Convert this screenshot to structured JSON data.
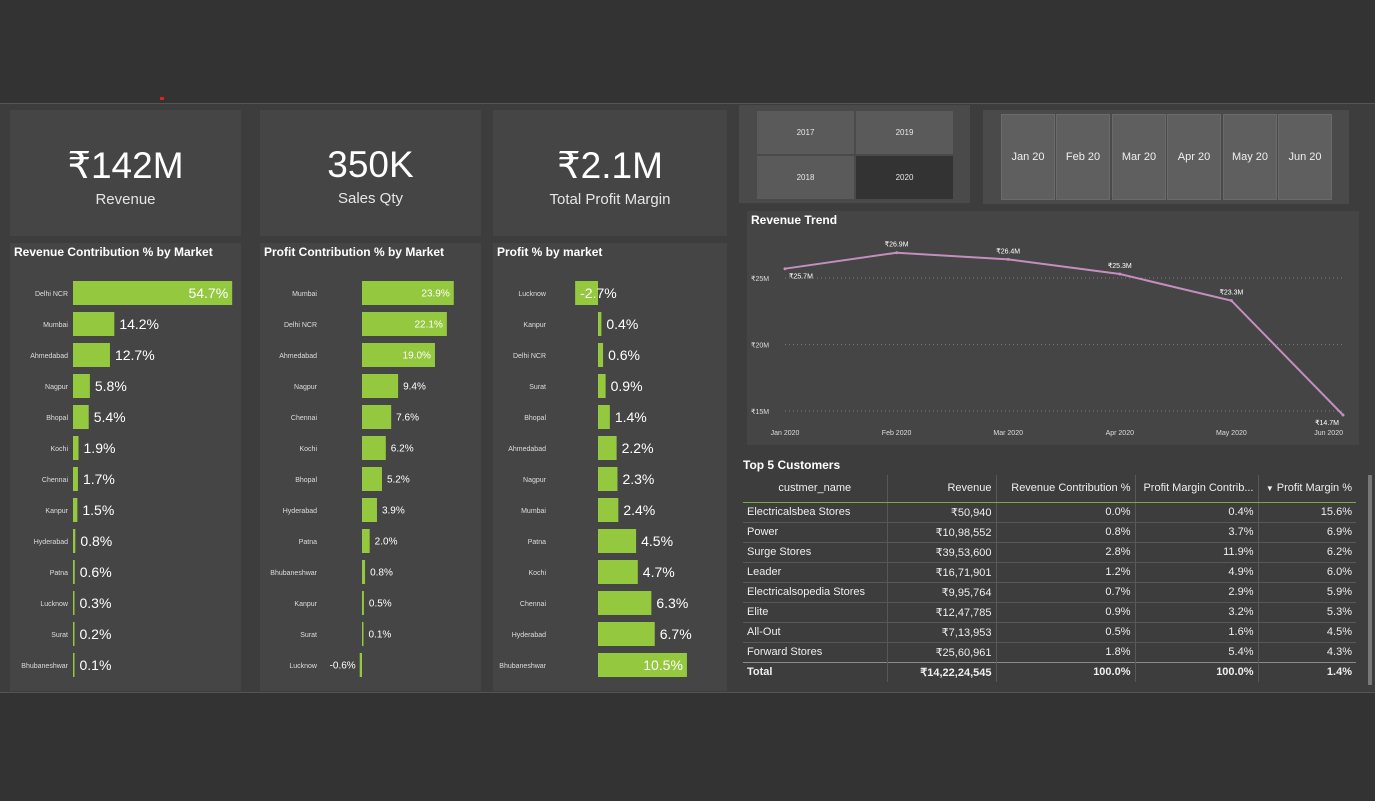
{
  "kpis": [
    {
      "value": "₹142M",
      "label": "Revenue"
    },
    {
      "value": "350K",
      "label": "Sales Qty"
    },
    {
      "value": "₹2.1M",
      "label": "Total Profit Margin"
    }
  ],
  "year_slicer": {
    "years": [
      "2017",
      "2019",
      "2018",
      "2020"
    ],
    "selected": "2020"
  },
  "month_slicer": {
    "months": [
      "Jan 20",
      "Feb 20",
      "Mar 20",
      "Apr 20",
      "May 20",
      "Jun 20"
    ]
  },
  "colors": {
    "bar": "#94c83e",
    "line": "#c48fbf",
    "background": "#333333",
    "panel": "#454545"
  },
  "chart_data": [
    {
      "type": "bar",
      "title": "Revenue Contribution % by Market",
      "categories": [
        "Delhi NCR",
        "Mumbai",
        "Ahmedabad",
        "Nagpur",
        "Bhopal",
        "Kochi",
        "Chennai",
        "Kanpur",
        "Hyderabad",
        "Patna",
        "Lucknow",
        "Surat",
        "Bhubaneshwar"
      ],
      "values": [
        54.7,
        14.2,
        12.7,
        5.8,
        5.4,
        1.9,
        1.7,
        1.5,
        0.8,
        0.6,
        0.3,
        0.2,
        0.1
      ],
      "labels": [
        "54.7%",
        "14.2%",
        "12.7%",
        "5.8%",
        "5.4%",
        "1.9%",
        "1.7%",
        "1.5%",
        "0.8%",
        "0.6%",
        "0.3%",
        "0.2%",
        "0.1%"
      ],
      "orientation": "horizontal"
    },
    {
      "type": "bar",
      "title": "Profit Contribution % by Market",
      "categories": [
        "Mumbai",
        "Delhi NCR",
        "Ahmedabad",
        "Nagpur",
        "Chennai",
        "Kochi",
        "Bhopal",
        "Hyderabad",
        "Patna",
        "Bhubaneshwar",
        "Kanpur",
        "Surat",
        "Lucknow"
      ],
      "values": [
        23.9,
        22.1,
        19.0,
        9.4,
        7.6,
        6.2,
        5.2,
        3.9,
        2.0,
        0.8,
        0.5,
        0.1,
        -0.6
      ],
      "labels": [
        "23.9%",
        "22.1%",
        "19.0%",
        "9.4%",
        "7.6%",
        "6.2%",
        "5.2%",
        "3.9%",
        "2.0%",
        "0.8%",
        "0.5%",
        "0.1%",
        "-0.6%"
      ],
      "orientation": "horizontal"
    },
    {
      "type": "bar",
      "title": "Profit % by market",
      "categories": [
        "Lucknow",
        "Kanpur",
        "Delhi NCR",
        "Surat",
        "Bhopal",
        "Ahmedabad",
        "Nagpur",
        "Mumbai",
        "Patna",
        "Kochi",
        "Chennai",
        "Hyderabad",
        "Bhubaneshwar"
      ],
      "values": [
        -2.7,
        0.4,
        0.6,
        0.9,
        1.4,
        2.2,
        2.3,
        2.4,
        4.5,
        4.7,
        6.3,
        6.7,
        10.5
      ],
      "labels": [
        "-2.7%",
        "0.4%",
        "0.6%",
        "0.9%",
        "1.4%",
        "2.2%",
        "2.3%",
        "2.4%",
        "4.5%",
        "4.7%",
        "6.3%",
        "6.7%",
        "10.5%"
      ],
      "orientation": "horizontal"
    },
    {
      "type": "line",
      "title": "Revenue Trend",
      "x": [
        "Jan 2020",
        "Feb 2020",
        "Mar 2020",
        "Apr 2020",
        "May 2020",
        "Jun 2020"
      ],
      "y": [
        25.7,
        26.9,
        26.4,
        25.3,
        23.3,
        14.7
      ],
      "labels": [
        "₹25.7M",
        "₹26.9M",
        "₹26.4M",
        "₹25.3M",
        "₹23.3M",
        "₹14.7M"
      ],
      "yticks": [
        "₹15M",
        "₹20M",
        "₹25M"
      ],
      "ytick_values": [
        15,
        20,
        25
      ],
      "grid": true
    },
    {
      "type": "table",
      "title": "Top 5 Customers",
      "columns": [
        "custmer_name",
        "Revenue",
        "Revenue Contribution %",
        "Profit Margin Contrib...",
        "Profit Margin %"
      ],
      "rows": [
        [
          "Electricalsbea Stores",
          "₹50,940",
          "0.0%",
          "0.4%",
          "15.6%"
        ],
        [
          "Power",
          "₹10,98,552",
          "0.8%",
          "3.7%",
          "6.9%"
        ],
        [
          "Surge Stores",
          "₹39,53,600",
          "2.8%",
          "11.9%",
          "6.2%"
        ],
        [
          "Leader",
          "₹16,71,901",
          "1.2%",
          "4.9%",
          "6.0%"
        ],
        [
          "Electricalsopedia Stores",
          "₹9,95,764",
          "0.7%",
          "2.9%",
          "5.9%"
        ],
        [
          "Elite",
          "₹12,47,785",
          "0.9%",
          "3.2%",
          "5.3%"
        ],
        [
          "All-Out",
          "₹7,13,953",
          "0.5%",
          "1.6%",
          "4.5%"
        ],
        [
          "Forward Stores",
          "₹25,60,961",
          "1.8%",
          "5.4%",
          "4.3%"
        ]
      ],
      "total": [
        "Total",
        "₹14,22,24,545",
        "100.0%",
        "100.0%",
        "1.4%"
      ]
    }
  ]
}
